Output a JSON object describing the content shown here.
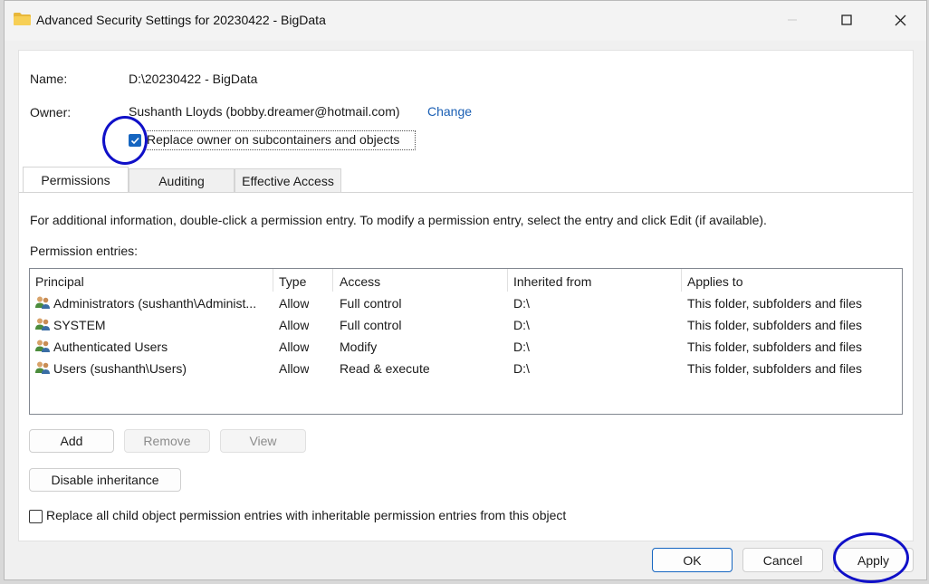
{
  "window": {
    "title": "Advanced Security Settings for 20230422 - BigData"
  },
  "info": {
    "name_label": "Name:",
    "name_value": "D:\\20230422 - BigData",
    "owner_label": "Owner:",
    "owner_value": "Sushanth Lloyds (bobby.dreamer@hotmail.com)",
    "change_link": "Change",
    "replace_owner_label": "Replace owner on subcontainers and objects",
    "replace_owner_checked": true
  },
  "tabs": [
    {
      "label": "Permissions",
      "active": true
    },
    {
      "label": "Auditing",
      "active": false
    },
    {
      "label": "Effective Access",
      "active": false
    }
  ],
  "permissions": {
    "info_text": "For additional information, double-click a permission entry. To modify a permission entry, select the entry and click Edit (if available).",
    "entries_label": "Permission entries:",
    "columns": [
      "Principal",
      "Type",
      "Access",
      "Inherited from",
      "Applies to"
    ],
    "rows": [
      {
        "principal": "Administrators (sushanth\\Administ...",
        "type": "Allow",
        "access": "Full control",
        "inherited": "D:\\",
        "applies": "This folder, subfolders and files"
      },
      {
        "principal": "SYSTEM",
        "type": "Allow",
        "access": "Full control",
        "inherited": "D:\\",
        "applies": "This folder, subfolders and files"
      },
      {
        "principal": "Authenticated Users",
        "type": "Allow",
        "access": "Modify",
        "inherited": "D:\\",
        "applies": "This folder, subfolders and files"
      },
      {
        "principal": "Users (sushanth\\Users)",
        "type": "Allow",
        "access": "Read & execute",
        "inherited": "D:\\",
        "applies": "This folder, subfolders and files"
      }
    ],
    "add_button": "Add",
    "remove_button": "Remove",
    "view_button": "View",
    "disable_inheritance_button": "Disable inheritance",
    "replace_child_label": "Replace all child object permission entries with inheritable permission entries from this object",
    "replace_child_checked": false
  },
  "footer": {
    "ok": "OK",
    "cancel": "Cancel",
    "apply": "Apply"
  },
  "colors": {
    "accent": "#1565c0",
    "annotation": "#1010c8",
    "link": "#1a5fb4"
  },
  "icons": [
    "folder-icon",
    "minimize-icon",
    "maximize-icon",
    "close-icon",
    "users-icon",
    "checkmark-icon"
  ]
}
